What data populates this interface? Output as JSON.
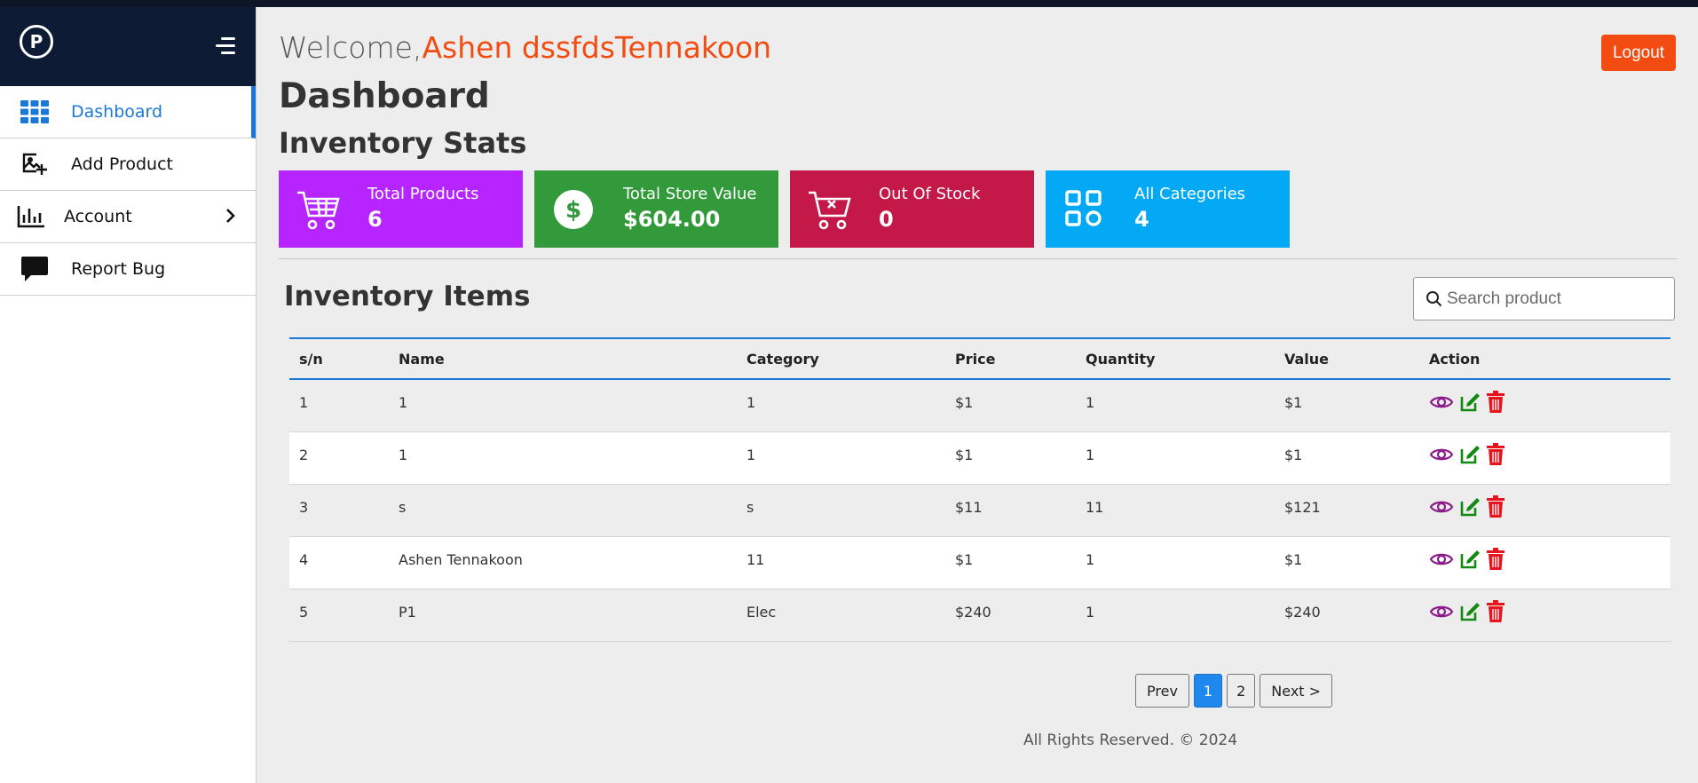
{
  "sidebar": {
    "logo_text": "P",
    "items": [
      {
        "label": "Dashboard",
        "icon": "grid-icon",
        "active": true
      },
      {
        "label": "Add Product",
        "icon": "add-image-icon"
      },
      {
        "label": "Account",
        "icon": "bar-chart-icon",
        "has_submenu": true
      },
      {
        "label": "Report Bug",
        "icon": "chat-bubble-icon"
      }
    ]
  },
  "header": {
    "welcome_prefix": "Welcome,",
    "user_name": "Ashen dssfdsTennakoon",
    "logout_label": "Logout",
    "page_title": "Dashboard",
    "stats_title": "Inventory Stats"
  },
  "stats": [
    {
      "label": "Total Products",
      "value": "6",
      "icon": "cart-icon",
      "color": "#b624ff"
    },
    {
      "label": "Total Store Value",
      "value": "$604.00",
      "icon": "dollar-icon",
      "color": "#329a3b"
    },
    {
      "label": "Out Of Stock",
      "value": "0",
      "icon": "cart-x-icon",
      "color": "#c41849"
    },
    {
      "label": "All Categories",
      "value": "4",
      "icon": "categories-icon",
      "color": "#03a9f4"
    }
  ],
  "inventory": {
    "title": "Inventory Items",
    "search_placeholder": "Search product",
    "columns": [
      "s/n",
      "Name",
      "Category",
      "Price",
      "Quantity",
      "Value",
      "Action"
    ],
    "rows": [
      [
        "1",
        "1",
        "1",
        "$1",
        "1",
        "$1"
      ],
      [
        "2",
        "1",
        "1",
        "$1",
        "1",
        "$1"
      ],
      [
        "3",
        "s",
        "s",
        "$11",
        "11",
        "$121"
      ],
      [
        "4",
        "Ashen Tennakoon",
        "11",
        "$1",
        "1",
        "$1"
      ],
      [
        "5",
        "P1",
        "Elec",
        "$240",
        "1",
        "$240"
      ]
    ]
  },
  "pagination": {
    "prev": "Prev",
    "pages": [
      "1",
      "2"
    ],
    "current": "1",
    "next": "Next >"
  },
  "footer": "All Rights Reserved. © 2024",
  "colors": {
    "accent": "#1b78d6",
    "brand": "#f24c12",
    "sidebar_head": "#0e1b34",
    "view": "#8b1d8b",
    "edit": "#128a12",
    "delete": "#e8141d"
  }
}
